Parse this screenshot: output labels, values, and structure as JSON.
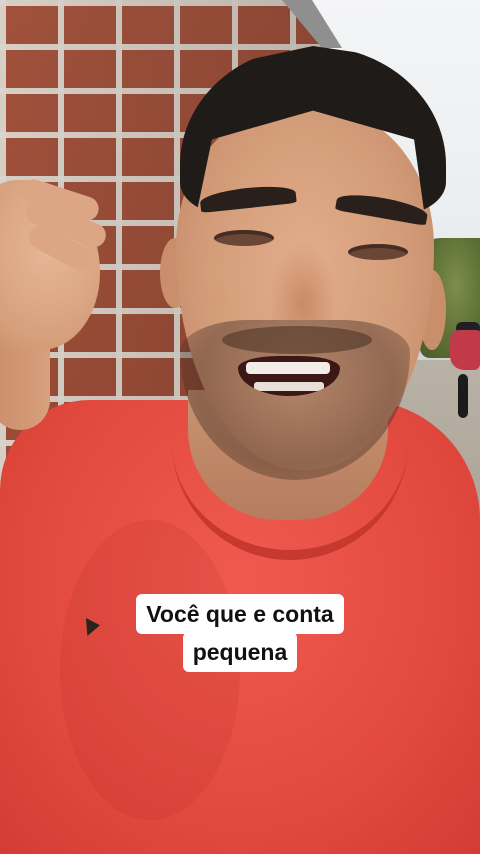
{
  "video": {
    "caption_lines": [
      "Você que e conta",
      "pequena"
    ],
    "colors": {
      "caption_background": "#ffffff",
      "caption_text": "#111111",
      "shirt": "#e34a3f",
      "brick": "#a9563f"
    }
  }
}
